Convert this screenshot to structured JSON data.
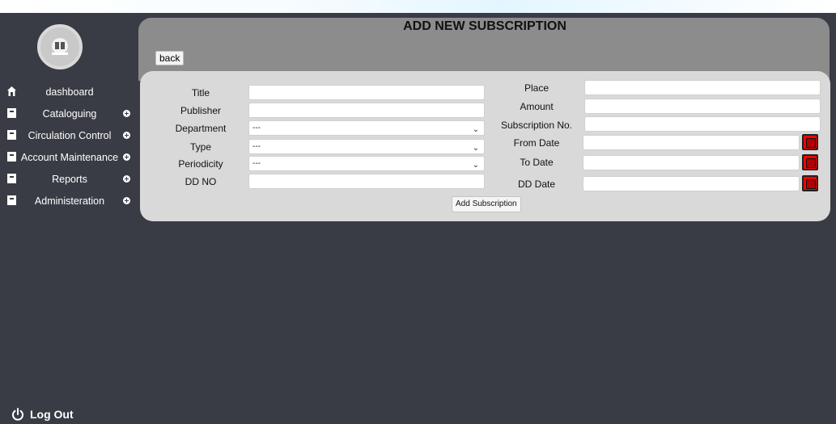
{
  "page": {
    "title": "ADD NEW SUBSCRIPTION",
    "back_label": "back"
  },
  "sidebar": {
    "items": [
      {
        "label": "dashboard",
        "icon": "home-icon",
        "expandable": false
      },
      {
        "label": "Cataloguing",
        "icon": "book-icon",
        "expandable": true
      },
      {
        "label": "Circulation Control",
        "icon": "book-icon",
        "expandable": true
      },
      {
        "label": "Account Maintenance",
        "icon": "book-icon",
        "expandable": true
      },
      {
        "label": "Reports",
        "icon": "book-icon",
        "expandable": true
      },
      {
        "label": "Administeration",
        "icon": "book-icon",
        "expandable": true
      }
    ],
    "logout_label": "Log Out"
  },
  "form": {
    "left": {
      "title_label": "Title",
      "publisher_label": "Publisher",
      "department_label": "Department",
      "department_value": "---",
      "type_label": "Type",
      "type_value": "---",
      "periodicity_label": "Periodicity",
      "periodicity_value": "---",
      "dd_no_label": "DD NO"
    },
    "right": {
      "place_label": "Place",
      "amount_label": "Amount",
      "subscription_no_label": "Subscription No.",
      "from_date_label": "From Date",
      "to_date_label": "To Date",
      "dd_date_label": "DD Date"
    },
    "submit_label": "Add Subscription"
  },
  "colors": {
    "background": "#393c44",
    "header_panel": "#8c8c8c",
    "form_panel": "#d9d9d9",
    "calendar_button": "#ff0000"
  }
}
